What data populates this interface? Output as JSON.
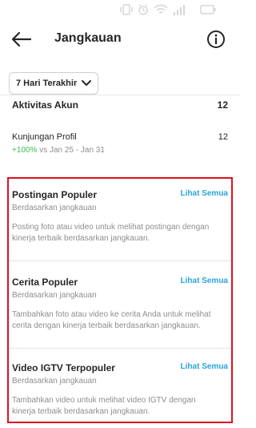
{
  "header": {
    "title": "Jangkauan"
  },
  "range_select": {
    "label": "7 Hari Terakhir"
  },
  "account": {
    "title": "Aktivitas Akun",
    "value": "12"
  },
  "visits": {
    "label": "Kunjungan Profil",
    "value": "12",
    "change_pct": "+100%",
    "change_period": "vs Jan 25 - Jan 31"
  },
  "sections": [
    {
      "title": "Postingan Populer",
      "subtitle": "Berdasarkan jangkauan",
      "link": "Lihat Semua",
      "desc_line1": "Posting foto atau video untuk melihat postingan dengan",
      "desc_line2": "kinerja terbaik berdasarkan jangkauan."
    },
    {
      "title": "Cerita Populer",
      "subtitle": "Berdasarkan jangkauan",
      "link": "Lihat Semua",
      "desc_line1": "Tambahkan foto atau video ke cerita Anda untuk melihat",
      "desc_line2": "cerita dengan kinerja terbaik berdasarkan jangkauan."
    },
    {
      "title": "Video IGTV Terpopuler",
      "subtitle": "Berdasarkan jangkauan",
      "link": "Lihat Semua",
      "desc_line1": "Tambahkan video untuk melihat video IGTV dengan",
      "desc_line2": "kinerja terbaik berdasarkan jangkauan."
    }
  ],
  "colors": {
    "link": "#2aa3e0",
    "positive": "#3fb950",
    "highlight": "#e0101e",
    "muted": "#8e8e8e"
  }
}
